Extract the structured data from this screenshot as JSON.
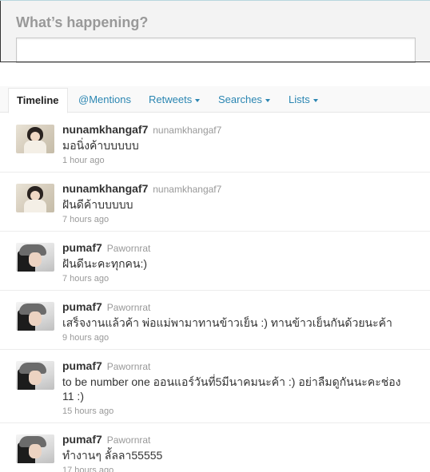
{
  "compose": {
    "title": "What’s happening?",
    "input_value": ""
  },
  "tabs": {
    "timeline": "Timeline",
    "mentions": "@Mentions",
    "retweets": "Retweets",
    "searches": "Searches",
    "lists": "Lists"
  },
  "tweets": [
    {
      "username": "nunamkhangaf7",
      "realname": "nunamkhangaf7",
      "text": "มอนิ่งค้าบบบบบ",
      "time": "1 hour ago"
    },
    {
      "username": "nunamkhangaf7",
      "realname": "nunamkhangaf7",
      "text": "ฝันดีค้าบบบบบ",
      "time": "7 hours ago"
    },
    {
      "username": "pumaf7",
      "realname": "Pawornrat",
      "text": "ฝันดีนะคะทุกคน:)",
      "time": "7 hours ago"
    },
    {
      "username": "pumaf7",
      "realname": "Pawornrat",
      "text": "เสร็จงานแล้วค้า พ่อแม่พามาทานข้าวเย็น :) ทานข้าวเย็นกันด้วยนะค้า",
      "time": "9 hours ago"
    },
    {
      "username": "pumaf7",
      "realname": "Pawornrat",
      "text": "to be number one ออนแอร์วันที่5มีนาคมนะค้า :) อย่าลืมดูกันนะคะช่อง 11 :)",
      "time": "15 hours ago"
    },
    {
      "username": "pumaf7",
      "realname": "Pawornrat",
      "text": "ทำงานๆ ลั้ลลา55555",
      "time": "17 hours ago"
    }
  ]
}
